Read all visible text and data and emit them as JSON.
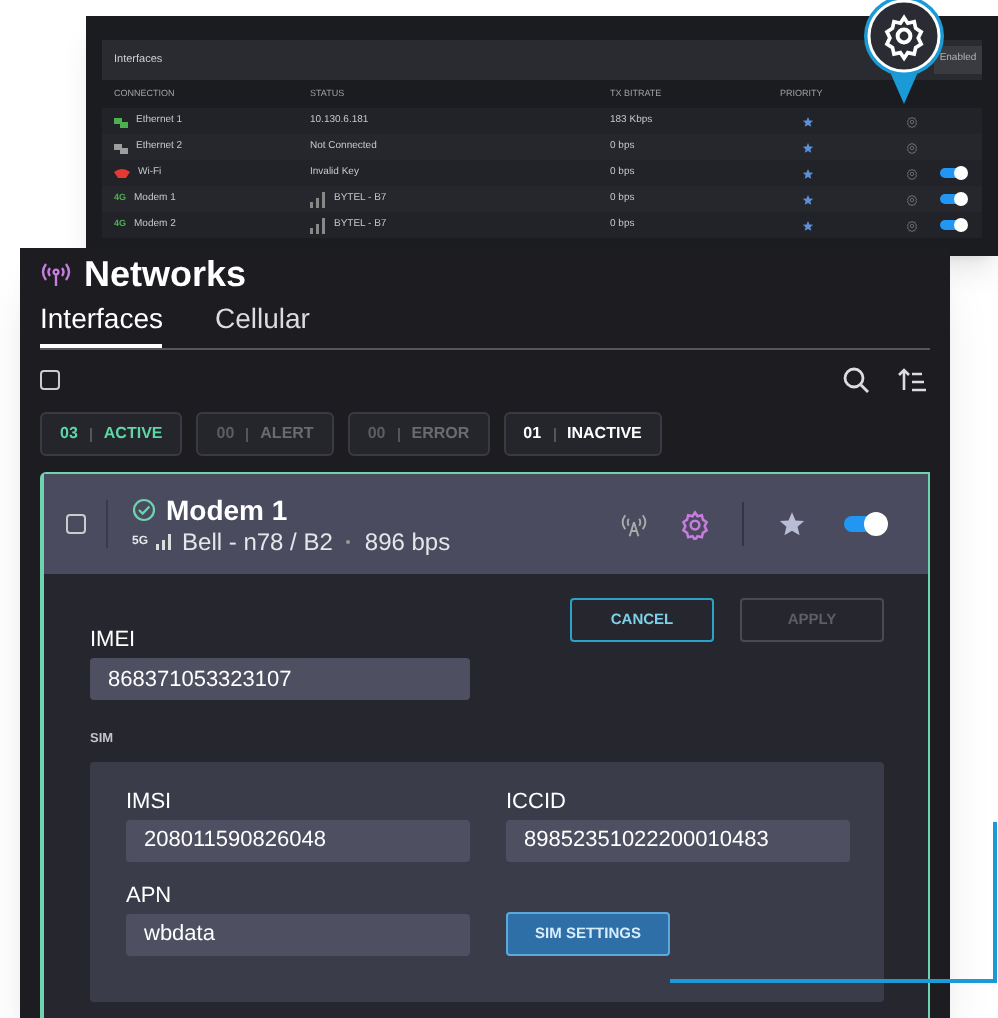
{
  "inset": {
    "title": "Interfaces",
    "button": "Enabled",
    "columns": [
      "CONNECTION",
      "STATUS",
      "TX BITRATE",
      "PRIORITY"
    ],
    "rows": [
      {
        "kind": "ethernet",
        "color": "#4caf50",
        "name": "Ethernet 1",
        "status": "10.130.6.181",
        "bitrate": "183 Kbps",
        "priority": true
      },
      {
        "kind": "ethernet",
        "color": "#9e9e9e",
        "name": "Ethernet 2",
        "status": "Not Connected",
        "bitrate": "0 bps",
        "priority": true
      },
      {
        "kind": "wifi",
        "color": "#e53935",
        "name": "Wi-Fi",
        "status": "Invalid Key",
        "bitrate": "0 bps",
        "priority": true,
        "enabled": true
      },
      {
        "kind": "cellular",
        "badge": "4G",
        "name": "Modem 1",
        "status": "BYTEL - B7",
        "bitrate": "0 bps",
        "priority": true,
        "enabled": true
      },
      {
        "kind": "cellular",
        "badge": "4G",
        "name": "Modem 2",
        "status": "BYTEL - B7",
        "bitrate": "0 bps",
        "priority": true,
        "enabled": true
      }
    ]
  },
  "title": "Networks",
  "tabs": [
    {
      "label": "Interfaces",
      "selected": true
    },
    {
      "label": "Cellular",
      "selected": false
    }
  ],
  "select_all": {
    "checked": false
  },
  "chips": [
    {
      "kind": "active",
      "count": "03",
      "label": "ACTIVE"
    },
    {
      "kind": "alert",
      "count": "00",
      "label": "ALERT"
    },
    {
      "kind": "error",
      "count": "00",
      "label": "ERROR"
    },
    {
      "kind": "inactive",
      "count": "01",
      "label": "INACTIVE"
    }
  ],
  "card": {
    "name": "Modem 1",
    "checked": false,
    "network": "5G",
    "carrier": "Bell - n78 / B2",
    "bitrate": "896 bps",
    "favorite": true,
    "enabled": true,
    "buttons": [
      {
        "label": "CANCEL",
        "disabled": false
      },
      {
        "label": "APPLY",
        "disabled": true
      }
    ],
    "imei": {
      "label": "IMEI",
      "value": "868371053323107"
    },
    "sim": {
      "title": "SIM",
      "fields": [
        {
          "label": "IMSI",
          "value": "208011590826048"
        },
        {
          "label": "ICCID",
          "value": "89852351022200010483"
        },
        {
          "label": "APN",
          "value": "wbdata"
        }
      ],
      "button": "SIM SETTINGS"
    }
  }
}
